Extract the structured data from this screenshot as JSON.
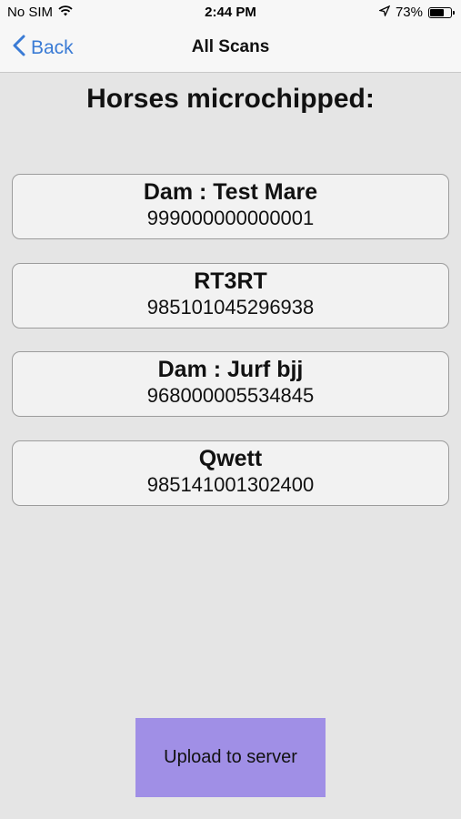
{
  "status_bar": {
    "carrier": "No SIM",
    "time": "2:44 PM",
    "battery_percent": "73%",
    "battery_level": 0.73,
    "icons": [
      "wifi-icon",
      "location-icon",
      "battery-icon"
    ]
  },
  "nav": {
    "back_label": "Back",
    "title": "All Scans"
  },
  "main": {
    "heading": "Horses microchipped:",
    "scans": [
      {
        "name": "Dam : Test Mare",
        "chip": "999000000000001"
      },
      {
        "name": "RT3RT",
        "chip": "985101045296938"
      },
      {
        "name": "Dam : Jurf bjj",
        "chip": "968000005534845"
      },
      {
        "name": "Qwett",
        "chip": "985141001302400"
      }
    ],
    "upload_label": "Upload to server"
  },
  "colors": {
    "accent": "#3a7bd5",
    "upload_button": "#a08fe6",
    "background": "#e5e5e5"
  }
}
